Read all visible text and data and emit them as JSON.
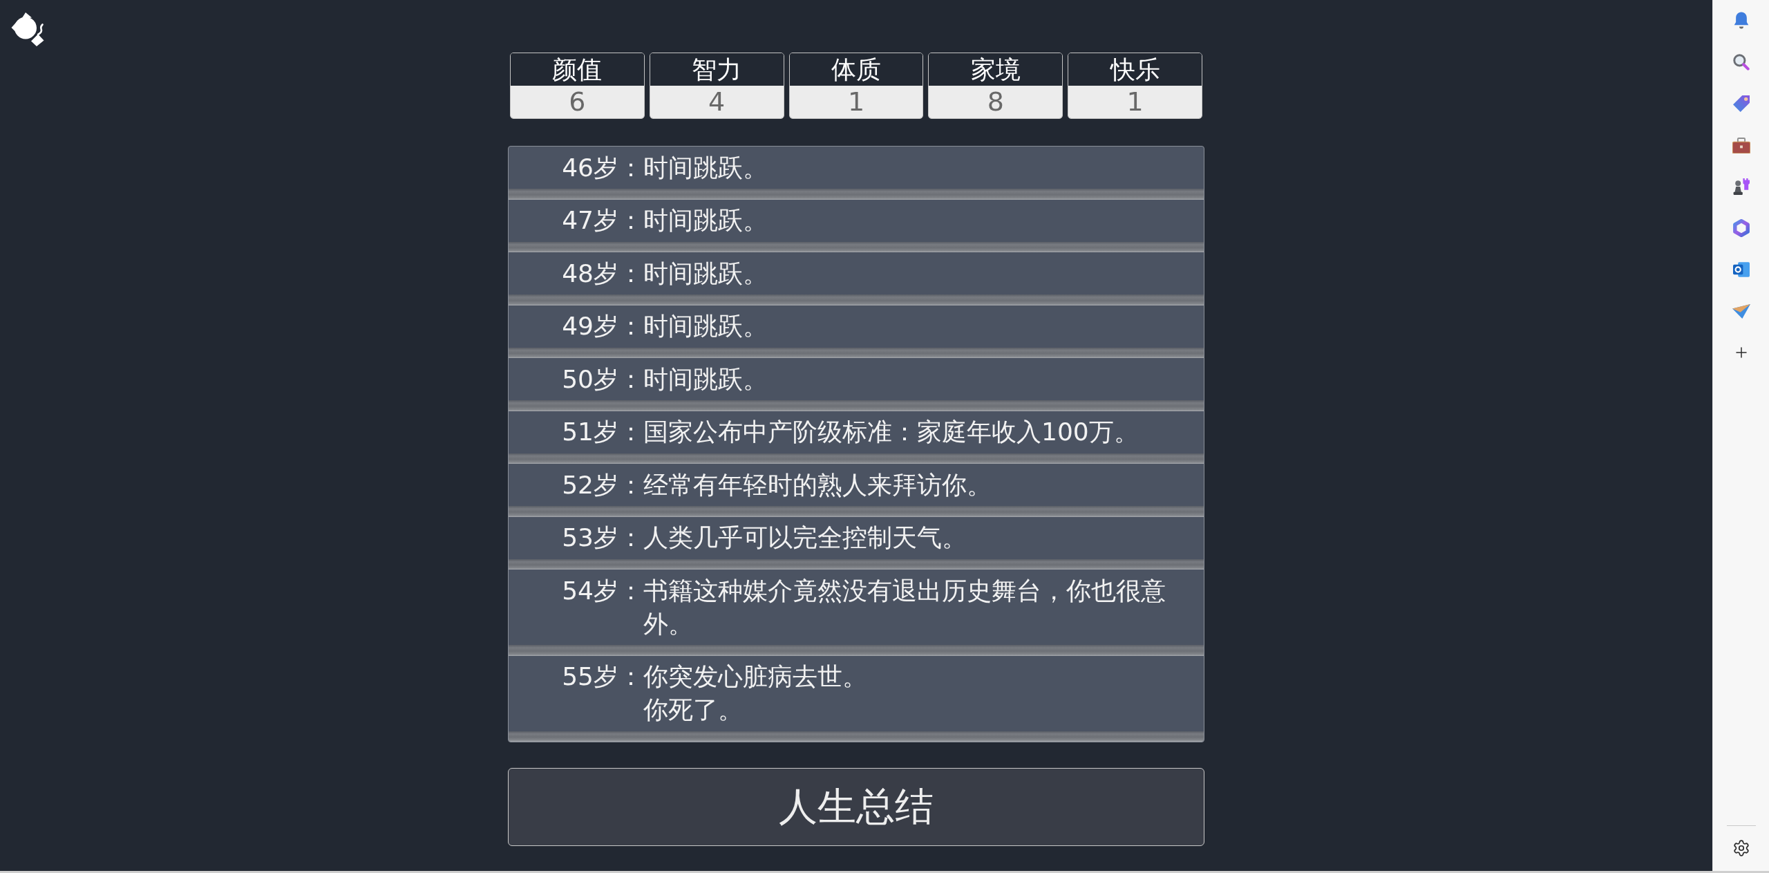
{
  "stats": [
    {
      "label": "颜值",
      "value": "6"
    },
    {
      "label": "智力",
      "value": "4"
    },
    {
      "label": "体质",
      "value": "1"
    },
    {
      "label": "家境",
      "value": "8"
    },
    {
      "label": "快乐",
      "value": "1"
    }
  ],
  "events": [
    {
      "age": "46岁：",
      "lines": [
        "时间跳跃。"
      ]
    },
    {
      "age": "47岁：",
      "lines": [
        "时间跳跃。"
      ]
    },
    {
      "age": "48岁：",
      "lines": [
        "时间跳跃。"
      ]
    },
    {
      "age": "49岁：",
      "lines": [
        "时间跳跃。"
      ]
    },
    {
      "age": "50岁：",
      "lines": [
        "时间跳跃。"
      ]
    },
    {
      "age": "51岁：",
      "lines": [
        "国家公布中产阶级标准：家庭年收入100万。"
      ]
    },
    {
      "age": "52岁：",
      "lines": [
        "经常有年轻时的熟人来拜访你。"
      ]
    },
    {
      "age": "53岁：",
      "lines": [
        "人类几乎可以完全控制天气。"
      ]
    },
    {
      "age": "54岁：",
      "lines": [
        "书籍这种媒介竟然没有退出历史舞台，你也很意外。"
      ]
    },
    {
      "age": "55岁：",
      "lines": [
        "你突发心脏病去世。",
        "你死了。"
      ]
    }
  ],
  "summary_button": {
    "label": "人生总结"
  }
}
